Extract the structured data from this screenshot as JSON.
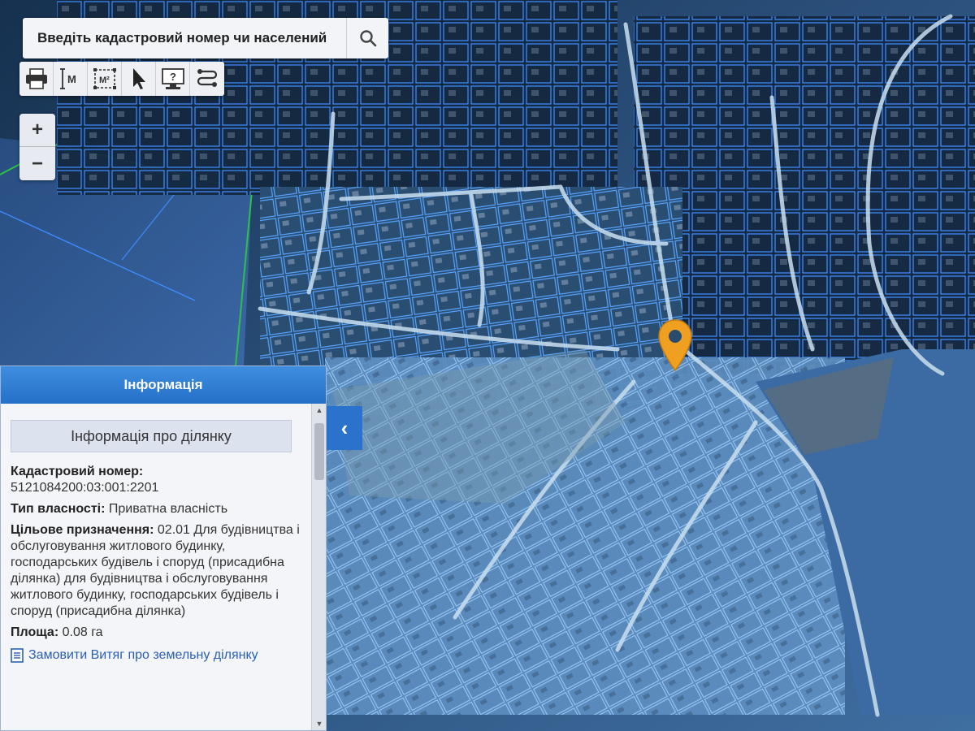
{
  "search": {
    "placeholder": "Введіть кадастровий номер чи населений"
  },
  "toolbar": {
    "tools": [
      {
        "icon": "printer-icon"
      },
      {
        "icon": "measure-distance-icon",
        "label": "M"
      },
      {
        "icon": "measure-area-icon",
        "label": "M²"
      },
      {
        "icon": "pointer-icon"
      },
      {
        "icon": "help-screen-icon"
      },
      {
        "icon": "route-icon"
      }
    ]
  },
  "zoom": {
    "in": "+",
    "out": "−"
  },
  "panel": {
    "title": "Інформація",
    "section_button": "Інформація про ділянку",
    "cadastral_label": "Кадастровий номер:",
    "cadastral_value": "5121084200:03:001:2201",
    "ownership_label": "Тип власності:",
    "ownership_value": "Приватна власність",
    "purpose_label": "Цільове призначення:",
    "purpose_value": "02.01 Для будівництва і обслуговування житлового будинку, господарських будівель і споруд (присадибна ділянка) для будівництва і обслуговування житлового будинку, господарських будівель і споруд (присадибна ділянка)",
    "area_label": "Площа:",
    "area_value": "0.08 га",
    "order_link": "Замовити Витяг про земельну ділянку"
  },
  "collapse_button": "‹",
  "colors": {
    "parcel_lines": "#3d8cff",
    "panel_header": "#2f7fd6",
    "marker": "#f0a020",
    "map_base": "#2a4f7a"
  }
}
